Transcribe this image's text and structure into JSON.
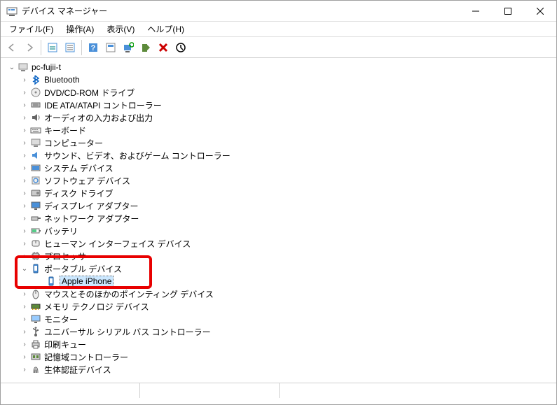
{
  "window": {
    "title": "デバイス マネージャー",
    "minimize": "−",
    "maximize": "☐",
    "close": "✕"
  },
  "menu": {
    "file": "ファイル(F)",
    "action": "操作(A)",
    "view": "表示(V)",
    "help": "ヘルプ(H)"
  },
  "tree": {
    "root": "pc-fujii-t",
    "nodes": [
      {
        "label": "Bluetooth",
        "icon": "bluetooth"
      },
      {
        "label": "DVD/CD-ROM ドライブ",
        "icon": "disc"
      },
      {
        "label": "IDE ATA/ATAPI コントローラー",
        "icon": "ide"
      },
      {
        "label": "オーディオの入力および出力",
        "icon": "audio"
      },
      {
        "label": "キーボード",
        "icon": "keyboard"
      },
      {
        "label": "コンピューター",
        "icon": "pc"
      },
      {
        "label": "サウンド、ビデオ、およびゲーム コントローラー",
        "icon": "sound"
      },
      {
        "label": "システム デバイス",
        "icon": "system"
      },
      {
        "label": "ソフトウェア デバイス",
        "icon": "software"
      },
      {
        "label": "ディスク ドライブ",
        "icon": "disk"
      },
      {
        "label": "ディスプレイ アダプター",
        "icon": "display"
      },
      {
        "label": "ネットワーク アダプター",
        "icon": "network"
      },
      {
        "label": "バッテリ",
        "icon": "battery"
      },
      {
        "label": "ヒューマン インターフェイス デバイス",
        "icon": "hid"
      },
      {
        "label": "プロセッサ",
        "icon": "cpu"
      },
      {
        "label": "ポータブル デバイス",
        "icon": "portable",
        "expanded": true,
        "children": [
          {
            "label": "Apple iPhone",
            "icon": "portable",
            "selected": true
          }
        ]
      },
      {
        "label": "マウスとそのほかのポインティング デバイス",
        "icon": "mouse",
        "obscured": true
      },
      {
        "label": "メモリ テクノロジ デバイス",
        "icon": "memory"
      },
      {
        "label": "モニター",
        "icon": "monitor"
      },
      {
        "label": "ユニバーサル シリアル バス コントローラー",
        "icon": "usb"
      },
      {
        "label": "印刷キュー",
        "icon": "printer"
      },
      {
        "label": "記憶域コントローラー",
        "icon": "storage"
      },
      {
        "label": "生体認証デバイス",
        "icon": "biometric"
      }
    ]
  }
}
